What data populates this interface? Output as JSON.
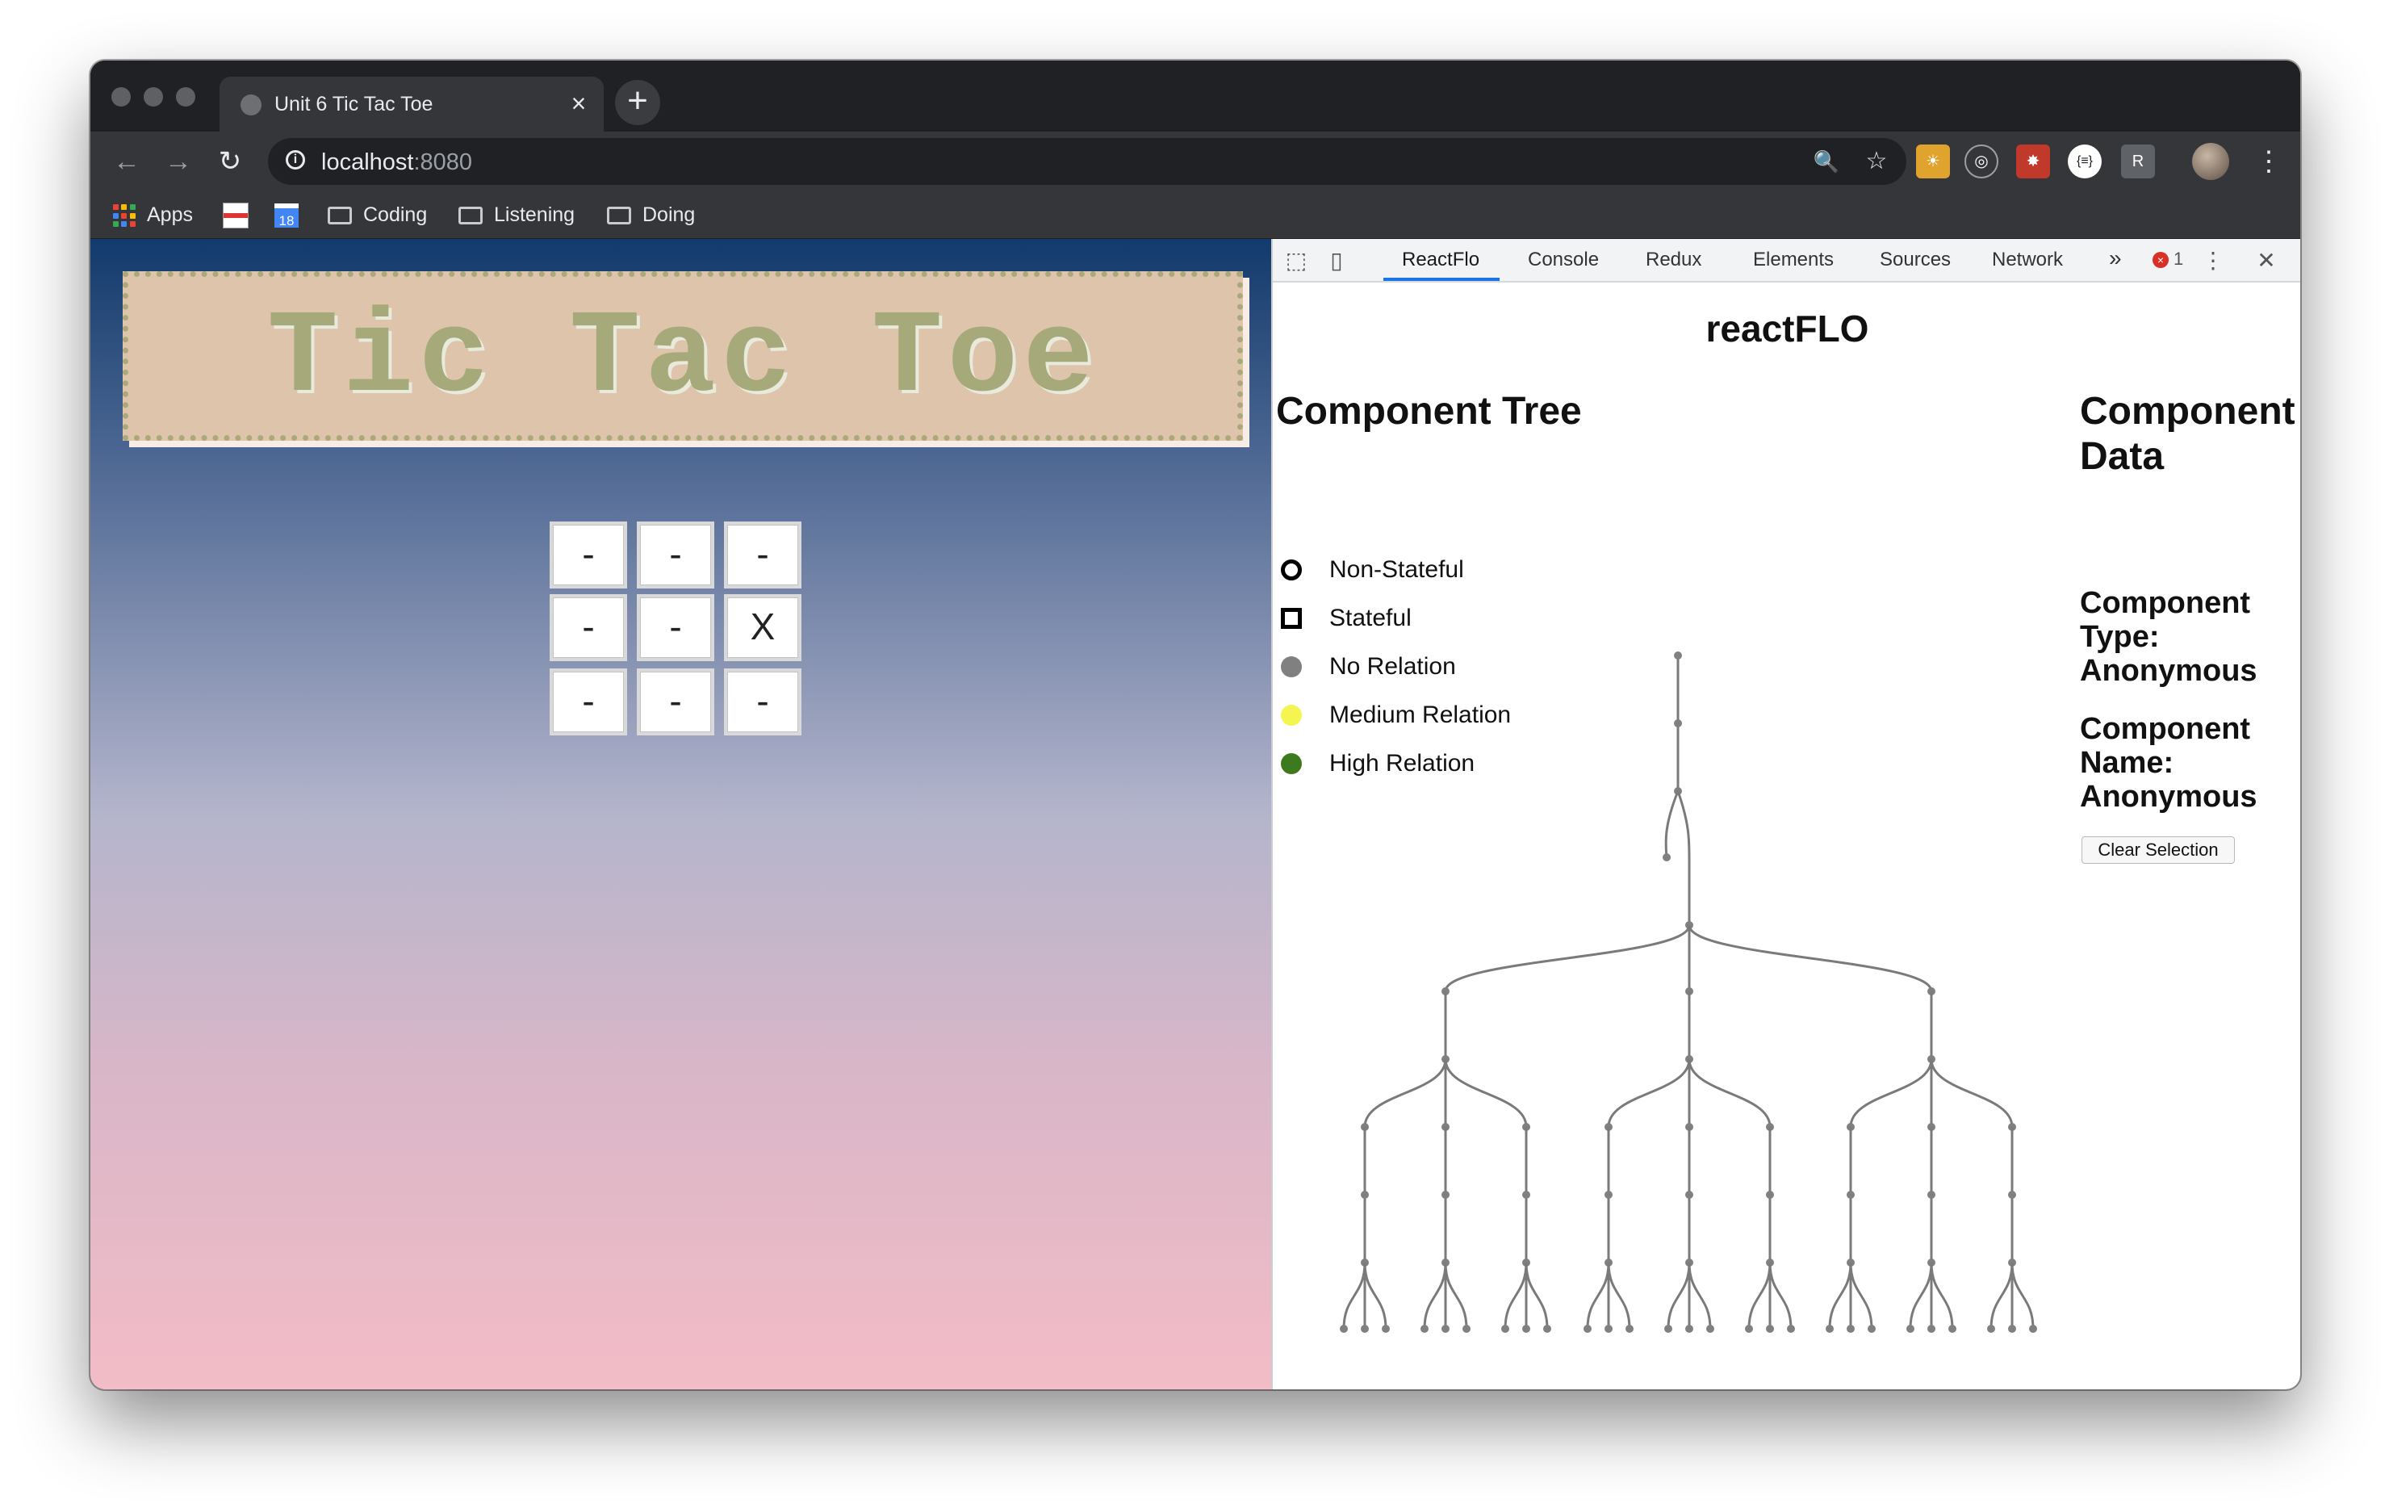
{
  "browser": {
    "tab_title": "Unit 6 Tic Tac Toe",
    "tab_close": "×",
    "new_tab": "+",
    "url_host": "localhost",
    "url_port": ":8080",
    "nav": {
      "back": "←",
      "forward": "→",
      "reload": "↻"
    },
    "omnibox_icons": {
      "zoom": "🔍",
      "star": "☆"
    },
    "extensions": [
      {
        "name": "sun-extension-icon",
        "color": "#e0a32e",
        "glyph": "☀"
      },
      {
        "name": "target-extension-icon",
        "color": "#35363a",
        "glyph": "◎"
      },
      {
        "name": "react-extension-icon",
        "color": "#c0392b",
        "glyph": "✸"
      },
      {
        "name": "json-extension-icon",
        "color": "#ffffff",
        "glyph": "{≡}"
      },
      {
        "name": "r-extension-icon",
        "color": "#5f6368",
        "glyph": "R"
      }
    ],
    "menu": "⋮",
    "bookmarks": [
      {
        "label": "Apps",
        "icon": "apps-grid-icon"
      },
      {
        "label": "",
        "icon": "bookmark-site-icon"
      },
      {
        "label": "18",
        "icon": "calendar-icon"
      },
      {
        "label": "Coding",
        "icon": "folder-icon"
      },
      {
        "label": "Listening",
        "icon": "folder-icon"
      },
      {
        "label": "Doing",
        "icon": "folder-icon"
      }
    ]
  },
  "game": {
    "title": "Tic Tac Toe",
    "board": [
      [
        "-",
        "-",
        "-"
      ],
      [
        "-",
        "-",
        "X"
      ],
      [
        "-",
        "-",
        "-"
      ]
    ]
  },
  "devtools": {
    "tabs": [
      "ReactFlo",
      "Console",
      "Redux",
      "Elements",
      "Sources",
      "Network"
    ],
    "active_tab": "ReactFlo",
    "more": "»",
    "error_count": "1",
    "error_glyph": "×",
    "kebab": "⋮",
    "close": "✕",
    "reactflo": {
      "title": "reactFLO",
      "component_tree_title": "Component Tree",
      "legend": [
        {
          "label": "Non-Stateful",
          "shape": "ring",
          "color": "#000000"
        },
        {
          "label": "Stateful",
          "shape": "square",
          "color": "#000000"
        },
        {
          "label": "No Relation",
          "shape": "dot",
          "color": "#808080"
        },
        {
          "label": "Medium Relation",
          "shape": "dot",
          "color": "#f5f552"
        },
        {
          "label": "High Relation",
          "shape": "dot",
          "color": "#3d7a1e"
        }
      ],
      "component_data_title": "Component Data",
      "component_type_label": "Component Type:",
      "component_type_value": "Anonymous",
      "component_name_label": "Component Name:",
      "component_name_value": "Anonymous",
      "clear_button": "Clear Selection"
    }
  }
}
